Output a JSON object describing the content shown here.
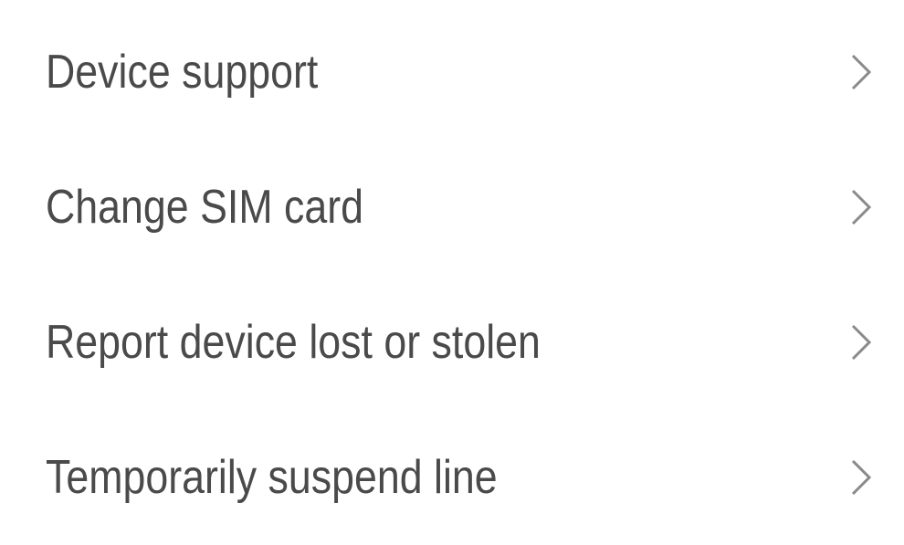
{
  "menu": {
    "items": [
      {
        "label": "Device support",
        "icon": "chevron-right-icon"
      },
      {
        "label": "Change SIM card",
        "icon": "chevron-right-icon"
      },
      {
        "label": "Report device lost or stolen",
        "icon": "chevron-right-icon"
      },
      {
        "label": "Temporarily suspend line",
        "icon": "chevron-right-icon"
      }
    ]
  },
  "colors": {
    "background": "#ffffff",
    "text": "#4a4a4a",
    "chevron": "#8a8a8a"
  }
}
